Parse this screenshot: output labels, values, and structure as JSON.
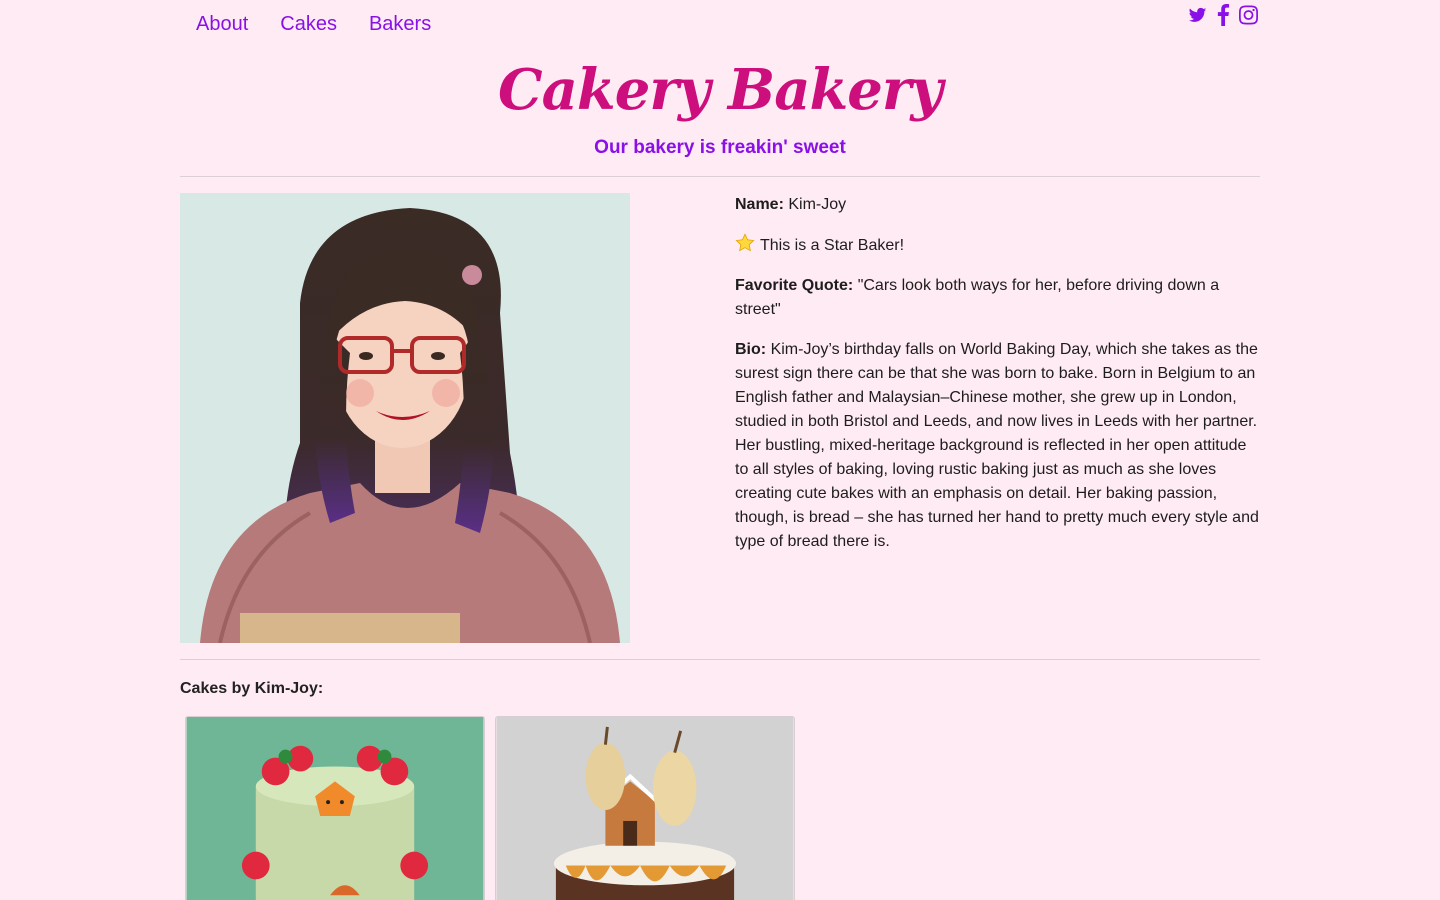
{
  "nav": {
    "items": [
      "About",
      "Cakes",
      "Bakers"
    ]
  },
  "social": {
    "icons": [
      "twitter-icon",
      "facebook-icon",
      "instagram-icon"
    ]
  },
  "header": {
    "brand": "Cakery Bakery",
    "tagline": "Our bakery is freakin' sweet"
  },
  "baker": {
    "name_label": "Name:",
    "name": "Kim-Joy",
    "star_text": "This is a Star Baker!",
    "quote_label": "Favorite Quote:",
    "quote": "\"Cars look both ways for her, before driving down a street\"",
    "bio_label": "Bio:",
    "bio": "Kim-Joy’s birthday falls on World Baking Day, which she takes as the surest sign there can be that she was born to bake. Born in Belgium to an English father and Malaysian–Chinese mother, she grew up in London, studied in both Bristol and Leeds, and now lives in Leeds with her partner. Her bustling, mixed-heritage background is reflected in her open attitude to all styles of baking, loving rustic baking just as much as she loves creating cute bakes with an emphasis on detail. Her baking passion, though, is bread – she has turned her hand to pretty much every style and type of bread there is."
  },
  "cakes": {
    "title": "Cakes by Kim-Joy:"
  },
  "colors": {
    "accent": "#8a10e8",
    "brand": "#cc0f7c",
    "background": "#ffebf3"
  }
}
